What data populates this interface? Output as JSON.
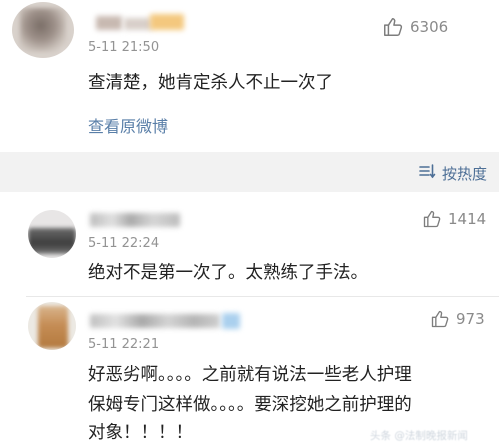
{
  "post": {
    "time": "5-11 21:50",
    "likes": "6306",
    "text": "查清楚，她肯定杀人不止一次了",
    "view_original": "查看原微博"
  },
  "sort": {
    "label": "按热度"
  },
  "replies": [
    {
      "time": "5-11 22:24",
      "likes": "1414",
      "text_lines": [
        "绝对不是第一次了。太熟练了手法。"
      ]
    },
    {
      "time": "5-11 22:21",
      "likes": "973",
      "text_lines": [
        "好恶劣啊。。。。之前就有说法一些老人护理",
        "保姆专门这样做。。。。要深挖她之前护理的",
        "对象！！！！"
      ]
    }
  ],
  "watermark": "头条 @法制晚报新闻",
  "colors": {
    "link": "#5a7fa8",
    "sort": "#4d6f96",
    "meta": "#939393",
    "separator": "#f2f2f2"
  },
  "icons": {
    "like": "thumbs-up-icon",
    "sort": "sort-icon"
  }
}
